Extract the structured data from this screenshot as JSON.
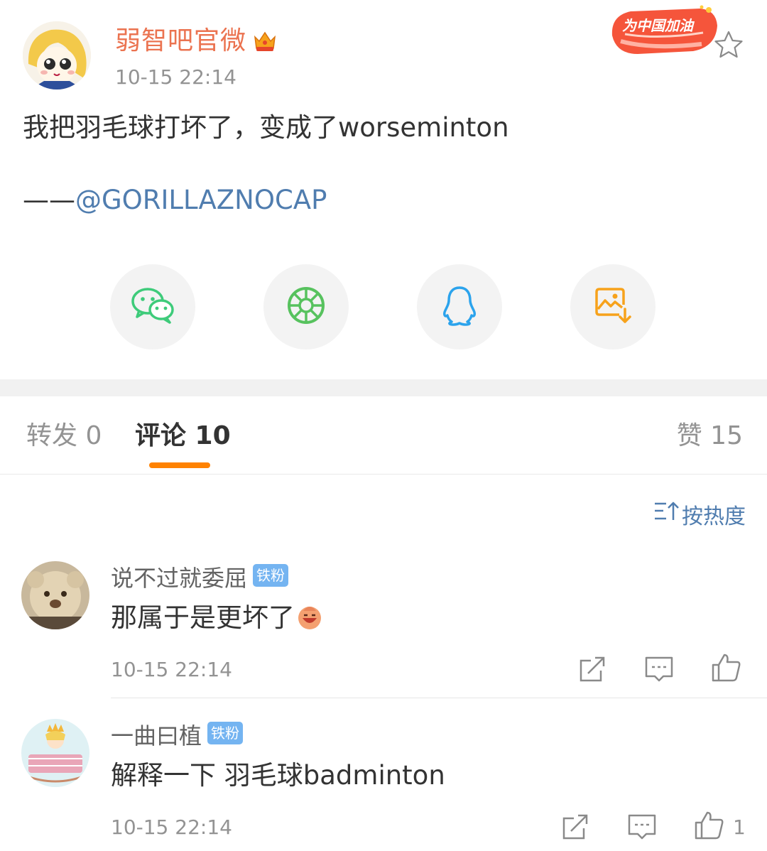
{
  "post": {
    "author": "弱智吧官微",
    "time": "10-15 22:14",
    "text": "我把羽毛球打坏了，变成了worseminton",
    "credit_prefix": "——",
    "credit_mention": "@GORILLAZNOCAP",
    "badge_text": "为中国加油"
  },
  "share": {
    "icons": [
      "wechat-icon",
      "moments-icon",
      "qq-icon",
      "save-image-icon"
    ]
  },
  "tabs": {
    "repost": "转发 0",
    "comments": "评论 10",
    "likes": "赞 15"
  },
  "sort": {
    "label": "按热度"
  },
  "comments": [
    {
      "name": "说不过就委屈",
      "badge": "铁粉",
      "text": "那属于是更坏了",
      "time": "10-15 22:14",
      "likes": ""
    },
    {
      "name": "一曲曰植",
      "badge": "铁粉",
      "text": "解释一下 羽毛球badminton",
      "time": "10-15 22:14",
      "likes": "1"
    }
  ],
  "colors": {
    "author": "#eb7350",
    "link": "#507daf",
    "accent": "#ff8200",
    "fan_badge": "#74b4f1",
    "muted": "#939393"
  }
}
